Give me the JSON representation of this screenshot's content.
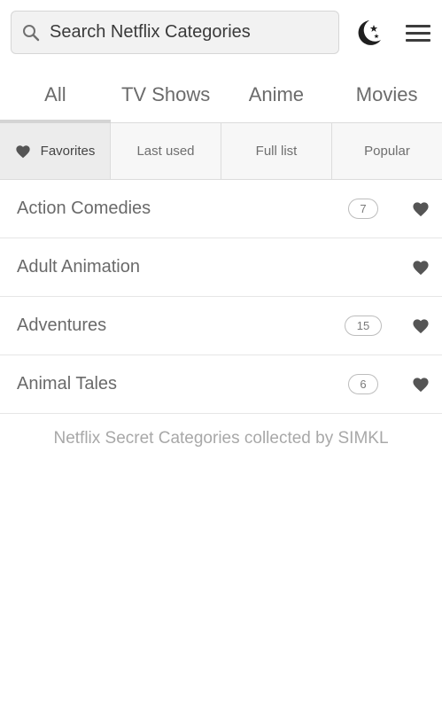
{
  "search": {
    "placeholder": "Search Netflix Categories",
    "icon": "search-icon"
  },
  "header": {
    "night_mode_icon": "moon-stars-icon",
    "menu_icon": "hamburger-menu-icon"
  },
  "main_tabs": [
    {
      "label": "All",
      "active": true
    },
    {
      "label": "TV Shows",
      "active": false
    },
    {
      "label": "Anime",
      "active": false
    },
    {
      "label": "Movies",
      "active": false
    }
  ],
  "filter_tabs": [
    {
      "label": "Favorites",
      "active": true,
      "icon": "heart-icon"
    },
    {
      "label": "Last used",
      "active": false
    },
    {
      "label": "Full list",
      "active": false
    },
    {
      "label": "Popular",
      "active": false
    }
  ],
  "categories": [
    {
      "name": "Action Comedies",
      "count": "7",
      "favorite": true
    },
    {
      "name": "Adult Animation",
      "count": "",
      "favorite": true
    },
    {
      "name": "Adventures",
      "count": "15",
      "favorite": true
    },
    {
      "name": "Animal Tales",
      "count": "6",
      "favorite": true
    }
  ],
  "footer_note": "Netflix Secret Categories collected by SIMKL",
  "colors": {
    "heart": "#555555",
    "search_bg": "#f2f2f2",
    "active_tab_underline": "#d4d4d4",
    "footer_text": "#a8a8a8"
  }
}
